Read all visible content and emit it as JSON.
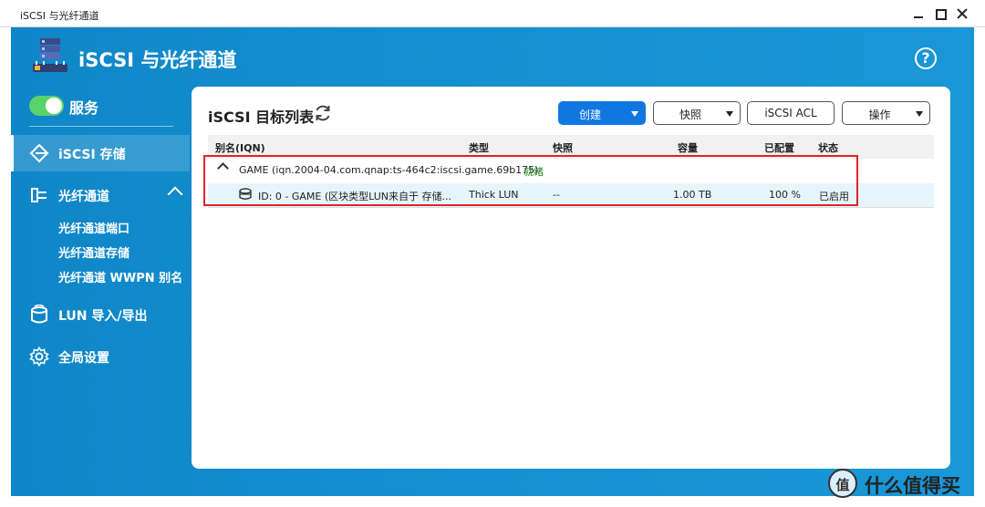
{
  "window": {
    "title": "iSCSI 与光纤通道",
    "controls": [
      "minimize-icon",
      "maximize-icon",
      "close-icon"
    ]
  },
  "header": {
    "app_title": "iSCSI 与光纤通道",
    "logo_icon": "server-storage-icon",
    "help_icon": "?"
  },
  "sidebar": {
    "service": {
      "label": "服务",
      "enabled": true
    },
    "items": [
      {
        "label": "iSCSI 存储",
        "icon": "storage-diamond-icon",
        "active": true
      },
      {
        "label": "光纤通道",
        "icon": "fibre-channel-icon",
        "expanded": true,
        "children": [
          "光纤通道端口",
          "光纤通道存储",
          "光纤通道 WWPN 别名"
        ]
      },
      {
        "label": "LUN 导入/导出",
        "icon": "lun-import-export-icon"
      },
      {
        "label": "全局设置",
        "icon": "gear-icon"
      }
    ]
  },
  "main": {
    "title": "iSCSI 目标列表",
    "toolbar": {
      "create": "创建",
      "snapshot": "快照",
      "acl": "iSCSI ACL",
      "actions": "操作"
    },
    "columns": {
      "alias": "别名(IQN)",
      "type": "类型",
      "snapshot": "快照",
      "capacity": "容量",
      "allocated": "已配置",
      "status": "状态"
    },
    "target": {
      "alias": "GAME (iqn.2004-04.com.qnap:ts-464c2:iscsi.game.69b175)",
      "status": "就绪"
    },
    "lun": {
      "name": "ID: 0 - GAME (区块类型LUN来自于 存储...",
      "type": "Thick LUN",
      "snapshot": "--",
      "capacity": "1.00 TB",
      "allocated": "100 %",
      "status": "已启用"
    }
  },
  "colors": {
    "brand_blue": "#148fcf",
    "primary_button": "#1177e0",
    "toggle_on": "#5ad26a",
    "status_ready": "#2b8a2b",
    "highlight_box": "#e2222a",
    "selected_row": "#e5f5fb"
  },
  "watermark": {
    "text": "什么值得买",
    "icon": "值"
  }
}
